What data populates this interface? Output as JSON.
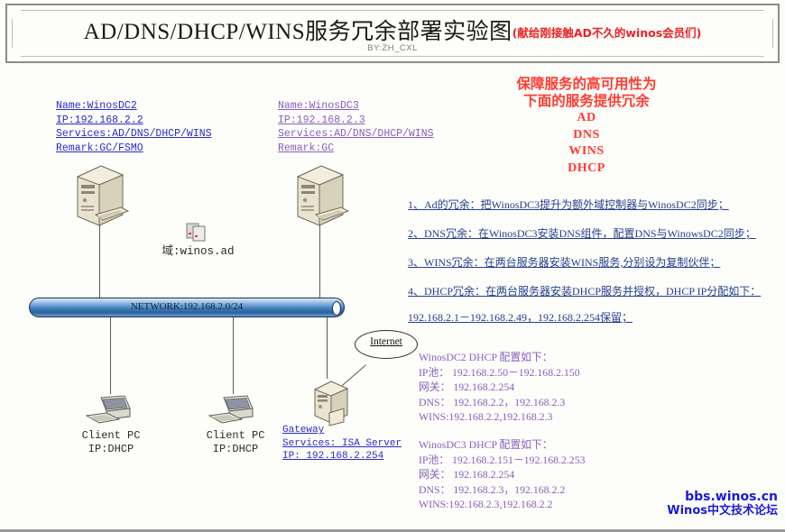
{
  "banner": {
    "title_main": "AD/DNS/DHCP/WINS服务冗余部署实验图",
    "title_sub": "(献给刚接触AD不久的winos会员们)",
    "byline": "BY:ZH_CXL"
  },
  "servers": [
    {
      "name_line": "Name:WinosDC2",
      "ip_line": "IP:192.168.2.2",
      "services_line": "Services:AD/DNS/DHCP/WINS",
      "remark_line": "Remark:GC/FSMO",
      "color": "#2a2ad0"
    },
    {
      "name_line": "Name:WinosDC3",
      "ip_line": "IP:192.168.2.3",
      "services_line": "Services:AD/DNS/DHCP/WINS",
      "remark_line": "Remark:GC",
      "color": "#8a5fbf"
    }
  ],
  "domain": {
    "label": "域:winos.ad"
  },
  "network": {
    "bar_label": "NETWORK:192.168.2.0/24",
    "cloud_label": "Internet"
  },
  "clients": [
    {
      "name": "Client PC",
      "ip": "IP:DHCP"
    },
    {
      "name": "Client PC",
      "ip": "IP:DHCP"
    }
  ],
  "gateway": {
    "name": "Gateway",
    "services": "Services: ISA Server",
    "ip": "IP: 192.168.2.254"
  },
  "redundancy_header": {
    "line1": "保障服务的高可用性为",
    "line2": "下面的服务提供冗余",
    "services": [
      "AD",
      "DNS",
      "WINS",
      "DHCP"
    ]
  },
  "notes": [
    "1、Ad的冗余：把WinosDC3提升为额外域控制器与WinosDC2同步；",
    "2、DNS冗余：在WinosDC3安装DNS组件，配置DNS与WinowsDC2同步；",
    "3、WINS冗余：在两台服务器安装WINS服务,分别设为复制伙伴；",
    "4、DHCP冗余：在两台服务器安装DHCP服务并授权，DHCP IP分配如下：",
    "   192.168.2.1－192.168.2.49，192.168.2.254保留；"
  ],
  "dhcp_configs": [
    {
      "title": "WinosDC2 DHCP 配置如下：",
      "pool": "IP池： 192.168.2.50－192.168.2.150",
      "gateway": "网关： 192.168.2.254",
      "dns": "DNS： 192.168.2.2，192.168.2.3",
      "wins": "WINS:192.168.2.2,192.168.2.3"
    },
    {
      "title": "WinosDC3 DHCP 配置如下：",
      "pool": "IP池： 192.168.2.151－192.168.2.253",
      "gateway": "网关： 192.168.2.254",
      "dns": "DNS： 192.168.2.3，192.168.2.2",
      "wins": "WINS:192.168.2.3,192.168.2.2"
    }
  ],
  "watermark": {
    "line1": "bbs.winos.cn",
    "line2": "Winos中文技术论坛"
  }
}
